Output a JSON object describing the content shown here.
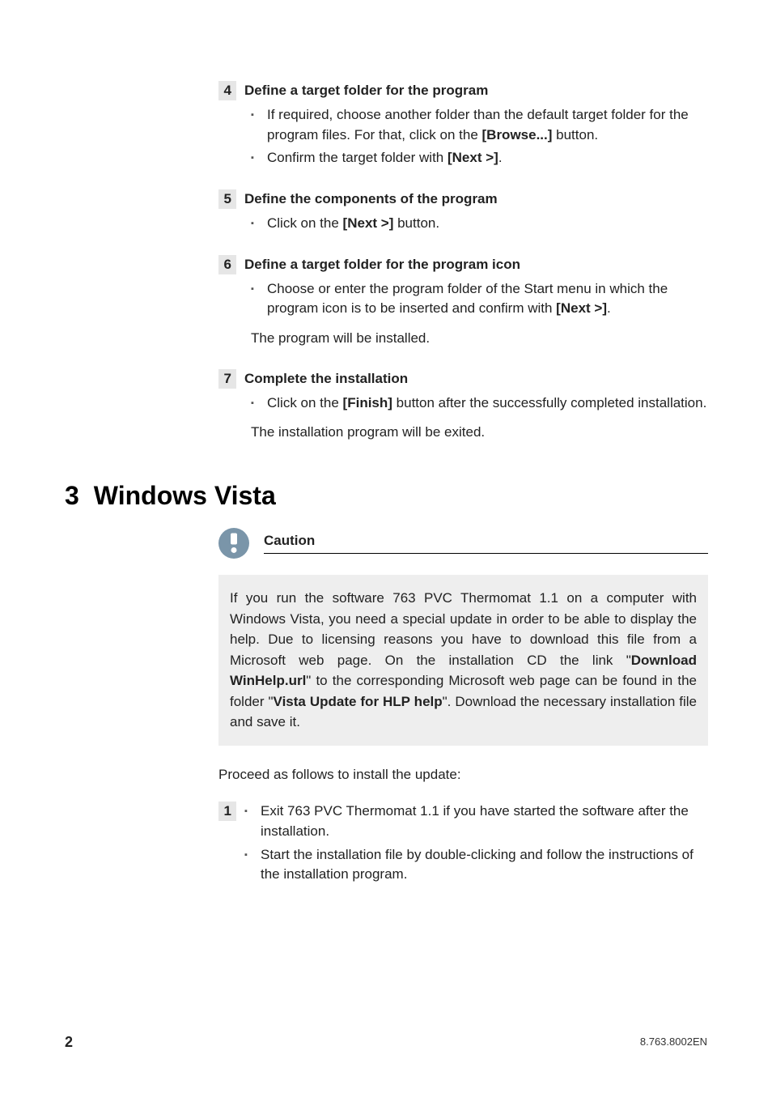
{
  "steps": [
    {
      "num": "4",
      "title": "Define a target folder for the program",
      "bullets_html": [
        "If required, choose another folder than the default target folder for the program files. For that, click on the <b>[Browse...]</b> button.",
        "Confirm the target folder with <b>[Next >]</b>."
      ],
      "result": ""
    },
    {
      "num": "5",
      "title": "Define the components of the program",
      "bullets_html": [
        "Click on the <b>[Next >]</b> button."
      ],
      "result": ""
    },
    {
      "num": "6",
      "title": "Define a target folder for the program icon",
      "bullets_html": [
        "Choose or enter the program folder of the Start menu in which the program icon is to be inserted and confirm with <b>[Next >]</b>."
      ],
      "result": "The program will be installed."
    },
    {
      "num": "7",
      "title": "Complete the installation",
      "bullets_html": [
        "Click on the <b>[Finish]</b> button after the successfully completed installation."
      ],
      "result": "The installation program will be exited."
    }
  ],
  "section": {
    "num": "3",
    "title": "Windows Vista"
  },
  "caution": {
    "label": "Caution",
    "body_html": "If you run the software 763 PVC Thermomat 1.1 on a computer with Windows Vista, you need a special update in order to be able to display the help. Due to licensing reasons you have to download this file from a Microsoft web page. On the installation CD the link \"<b>Download WinHelp.url</b>\" to the corresponding Microsoft web page can be found in the folder \"<b>Vista Update for HLP help</b>\". Download the necessary installation file and save it."
  },
  "proceed": "Proceed as follows to install the update:",
  "vista_step": {
    "num": "1",
    "bullets_html": [
      "Exit 763 PVC Thermomat 1.1 if you have started the software after the installation.",
      "Start the installation file by double-clicking and follow the instructions of the installation program."
    ]
  },
  "footer": {
    "page": "2",
    "code": "8.763.8002EN"
  }
}
